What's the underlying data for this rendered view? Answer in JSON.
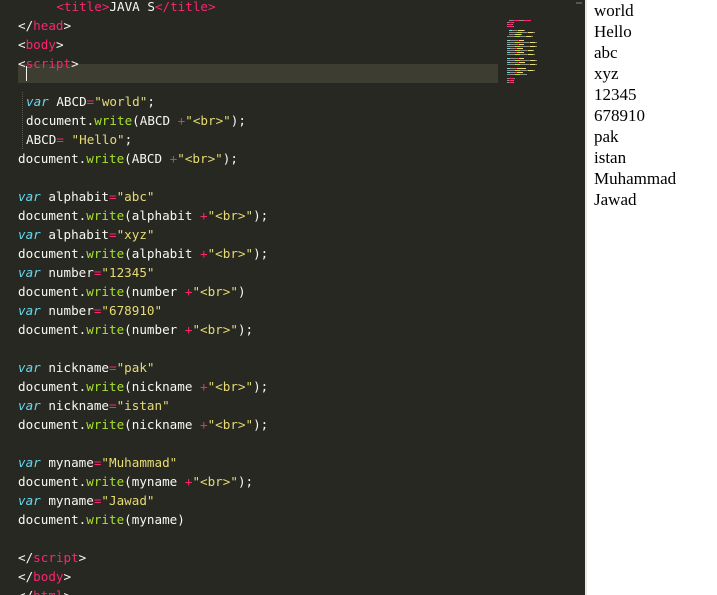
{
  "editor": {
    "lines": [
      {
        "indent": true,
        "tokens": [
          [
            "pl",
            "    "
          ],
          [
            "tag",
            "<title>"
          ],
          [
            "pl",
            "JAVA S"
          ],
          [
            "tag",
            "</title>"
          ]
        ]
      },
      {
        "tokens": [
          [
            "pl",
            "</"
          ],
          [
            "tag",
            "head"
          ],
          [
            "pl",
            ">"
          ]
        ]
      },
      {
        "tokens": [
          [
            "pl",
            "<"
          ],
          [
            "tag",
            "body"
          ],
          [
            "pl",
            ">"
          ]
        ]
      },
      {
        "tokens": [
          [
            "pl",
            "<"
          ],
          [
            "tag",
            "script"
          ],
          [
            "pl",
            ">"
          ]
        ]
      },
      {
        "tokens": []
      },
      {
        "indent": true,
        "tokens": [
          [
            "kw",
            "var"
          ],
          [
            "pl",
            " ABCD"
          ],
          [
            "op",
            "="
          ],
          [
            "str",
            "\"world\""
          ],
          [
            "pl",
            ";"
          ]
        ]
      },
      {
        "indent": true,
        "tokens": [
          [
            "pl",
            "document."
          ],
          [
            "fn",
            "write"
          ],
          [
            "pl",
            "(ABCD "
          ],
          [
            "op",
            "+"
          ],
          [
            "str",
            "\"<br>\""
          ],
          [
            "pl",
            ");"
          ]
        ]
      },
      {
        "indent": true,
        "tokens": [
          [
            "pl",
            "ABCD"
          ],
          [
            "op",
            "="
          ],
          [
            "pl",
            " "
          ],
          [
            "str",
            "\"Hello\""
          ],
          [
            "pl",
            ";"
          ]
        ]
      },
      {
        "tokens": [
          [
            "pl",
            "document."
          ],
          [
            "fn",
            "write"
          ],
          [
            "pl",
            "(ABCD "
          ],
          [
            "op",
            "+"
          ],
          [
            "str",
            "\"<br>\""
          ],
          [
            "pl",
            ");"
          ]
        ]
      },
      {
        "tokens": []
      },
      {
        "tokens": [
          [
            "kw",
            "var"
          ],
          [
            "pl",
            " alphabit"
          ],
          [
            "op",
            "="
          ],
          [
            "str",
            "\"abc\""
          ]
        ]
      },
      {
        "tokens": [
          [
            "pl",
            "document."
          ],
          [
            "fn",
            "write"
          ],
          [
            "pl",
            "(alphabit "
          ],
          [
            "op",
            "+"
          ],
          [
            "str",
            "\"<br>\""
          ],
          [
            "pl",
            ");"
          ]
        ]
      },
      {
        "tokens": [
          [
            "kw",
            "var"
          ],
          [
            "pl",
            " alphabit"
          ],
          [
            "op",
            "="
          ],
          [
            "str",
            "\"xyz\""
          ]
        ]
      },
      {
        "tokens": [
          [
            "pl",
            "document."
          ],
          [
            "fn",
            "write"
          ],
          [
            "pl",
            "(alphabit "
          ],
          [
            "op",
            "+"
          ],
          [
            "str",
            "\"<br>\""
          ],
          [
            "pl",
            ");"
          ]
        ]
      },
      {
        "tokens": [
          [
            "kw",
            "var"
          ],
          [
            "pl",
            " number"
          ],
          [
            "op",
            "="
          ],
          [
            "str",
            "\"12345\""
          ]
        ]
      },
      {
        "tokens": [
          [
            "pl",
            "document."
          ],
          [
            "fn",
            "write"
          ],
          [
            "pl",
            "(number "
          ],
          [
            "op",
            "+"
          ],
          [
            "str",
            "\"<br>\""
          ],
          [
            "pl",
            ")"
          ]
        ]
      },
      {
        "tokens": [
          [
            "kw",
            "var"
          ],
          [
            "pl",
            " number"
          ],
          [
            "op",
            "="
          ],
          [
            "str",
            "\"678910\""
          ]
        ]
      },
      {
        "tokens": [
          [
            "pl",
            "document."
          ],
          [
            "fn",
            "write"
          ],
          [
            "pl",
            "(number "
          ],
          [
            "op",
            "+"
          ],
          [
            "str",
            "\"<br>\""
          ],
          [
            "pl",
            ");"
          ]
        ]
      },
      {
        "tokens": []
      },
      {
        "tokens": [
          [
            "kw",
            "var"
          ],
          [
            "pl",
            " nickname"
          ],
          [
            "op",
            "="
          ],
          [
            "str",
            "\"pak\""
          ]
        ]
      },
      {
        "tokens": [
          [
            "pl",
            "document."
          ],
          [
            "fn",
            "write"
          ],
          [
            "pl",
            "(nickname "
          ],
          [
            "op",
            "+"
          ],
          [
            "str",
            "\"<br>\""
          ],
          [
            "pl",
            ");"
          ]
        ]
      },
      {
        "tokens": [
          [
            "kw",
            "var"
          ],
          [
            "pl",
            " nickname"
          ],
          [
            "op",
            "="
          ],
          [
            "str",
            "\"istan\""
          ]
        ]
      },
      {
        "tokens": [
          [
            "pl",
            "document."
          ],
          [
            "fn",
            "write"
          ],
          [
            "pl",
            "(nickname "
          ],
          [
            "op",
            "+"
          ],
          [
            "str",
            "\"<br>\""
          ],
          [
            "pl",
            ");"
          ]
        ]
      },
      {
        "tokens": []
      },
      {
        "tokens": [
          [
            "kw",
            "var"
          ],
          [
            "pl",
            " myname"
          ],
          [
            "op",
            "="
          ],
          [
            "str",
            "\"Muhammad\""
          ]
        ]
      },
      {
        "tokens": [
          [
            "pl",
            "document."
          ],
          [
            "fn",
            "write"
          ],
          [
            "pl",
            "(myname "
          ],
          [
            "op",
            "+"
          ],
          [
            "str",
            "\"<br>\""
          ],
          [
            "pl",
            ");"
          ]
        ]
      },
      {
        "tokens": [
          [
            "kw",
            "var"
          ],
          [
            "pl",
            " myname"
          ],
          [
            "op",
            "="
          ],
          [
            "str",
            "\"Jawad\""
          ]
        ]
      },
      {
        "tokens": [
          [
            "pl",
            "document."
          ],
          [
            "fn",
            "write"
          ],
          [
            "pl",
            "(myname)"
          ]
        ]
      },
      {
        "tokens": []
      },
      {
        "tokens": [
          [
            "pl",
            "</"
          ],
          [
            "tag",
            "script"
          ],
          [
            "pl",
            ">"
          ]
        ]
      },
      {
        "tokens": [
          [
            "pl",
            "</"
          ],
          [
            "tag",
            "body"
          ],
          [
            "pl",
            ">"
          ]
        ]
      },
      {
        "tokens": [
          [
            "pl",
            "</"
          ],
          [
            "tag",
            "html"
          ],
          [
            "pl",
            ">"
          ]
        ]
      }
    ]
  },
  "colors": {
    "editor_bg": "#272822",
    "current_line": "#3e3d32",
    "tag": "#f92672",
    "keyword": "#66d9ef",
    "string": "#e6db74",
    "function": "#a6e22e",
    "plain": "#f8f8f2"
  },
  "preview": {
    "output": [
      "world",
      "Hello",
      "abc",
      "xyz",
      "12345",
      "678910",
      "pak",
      "istan",
      "Muhammad",
      "Jawad"
    ]
  }
}
